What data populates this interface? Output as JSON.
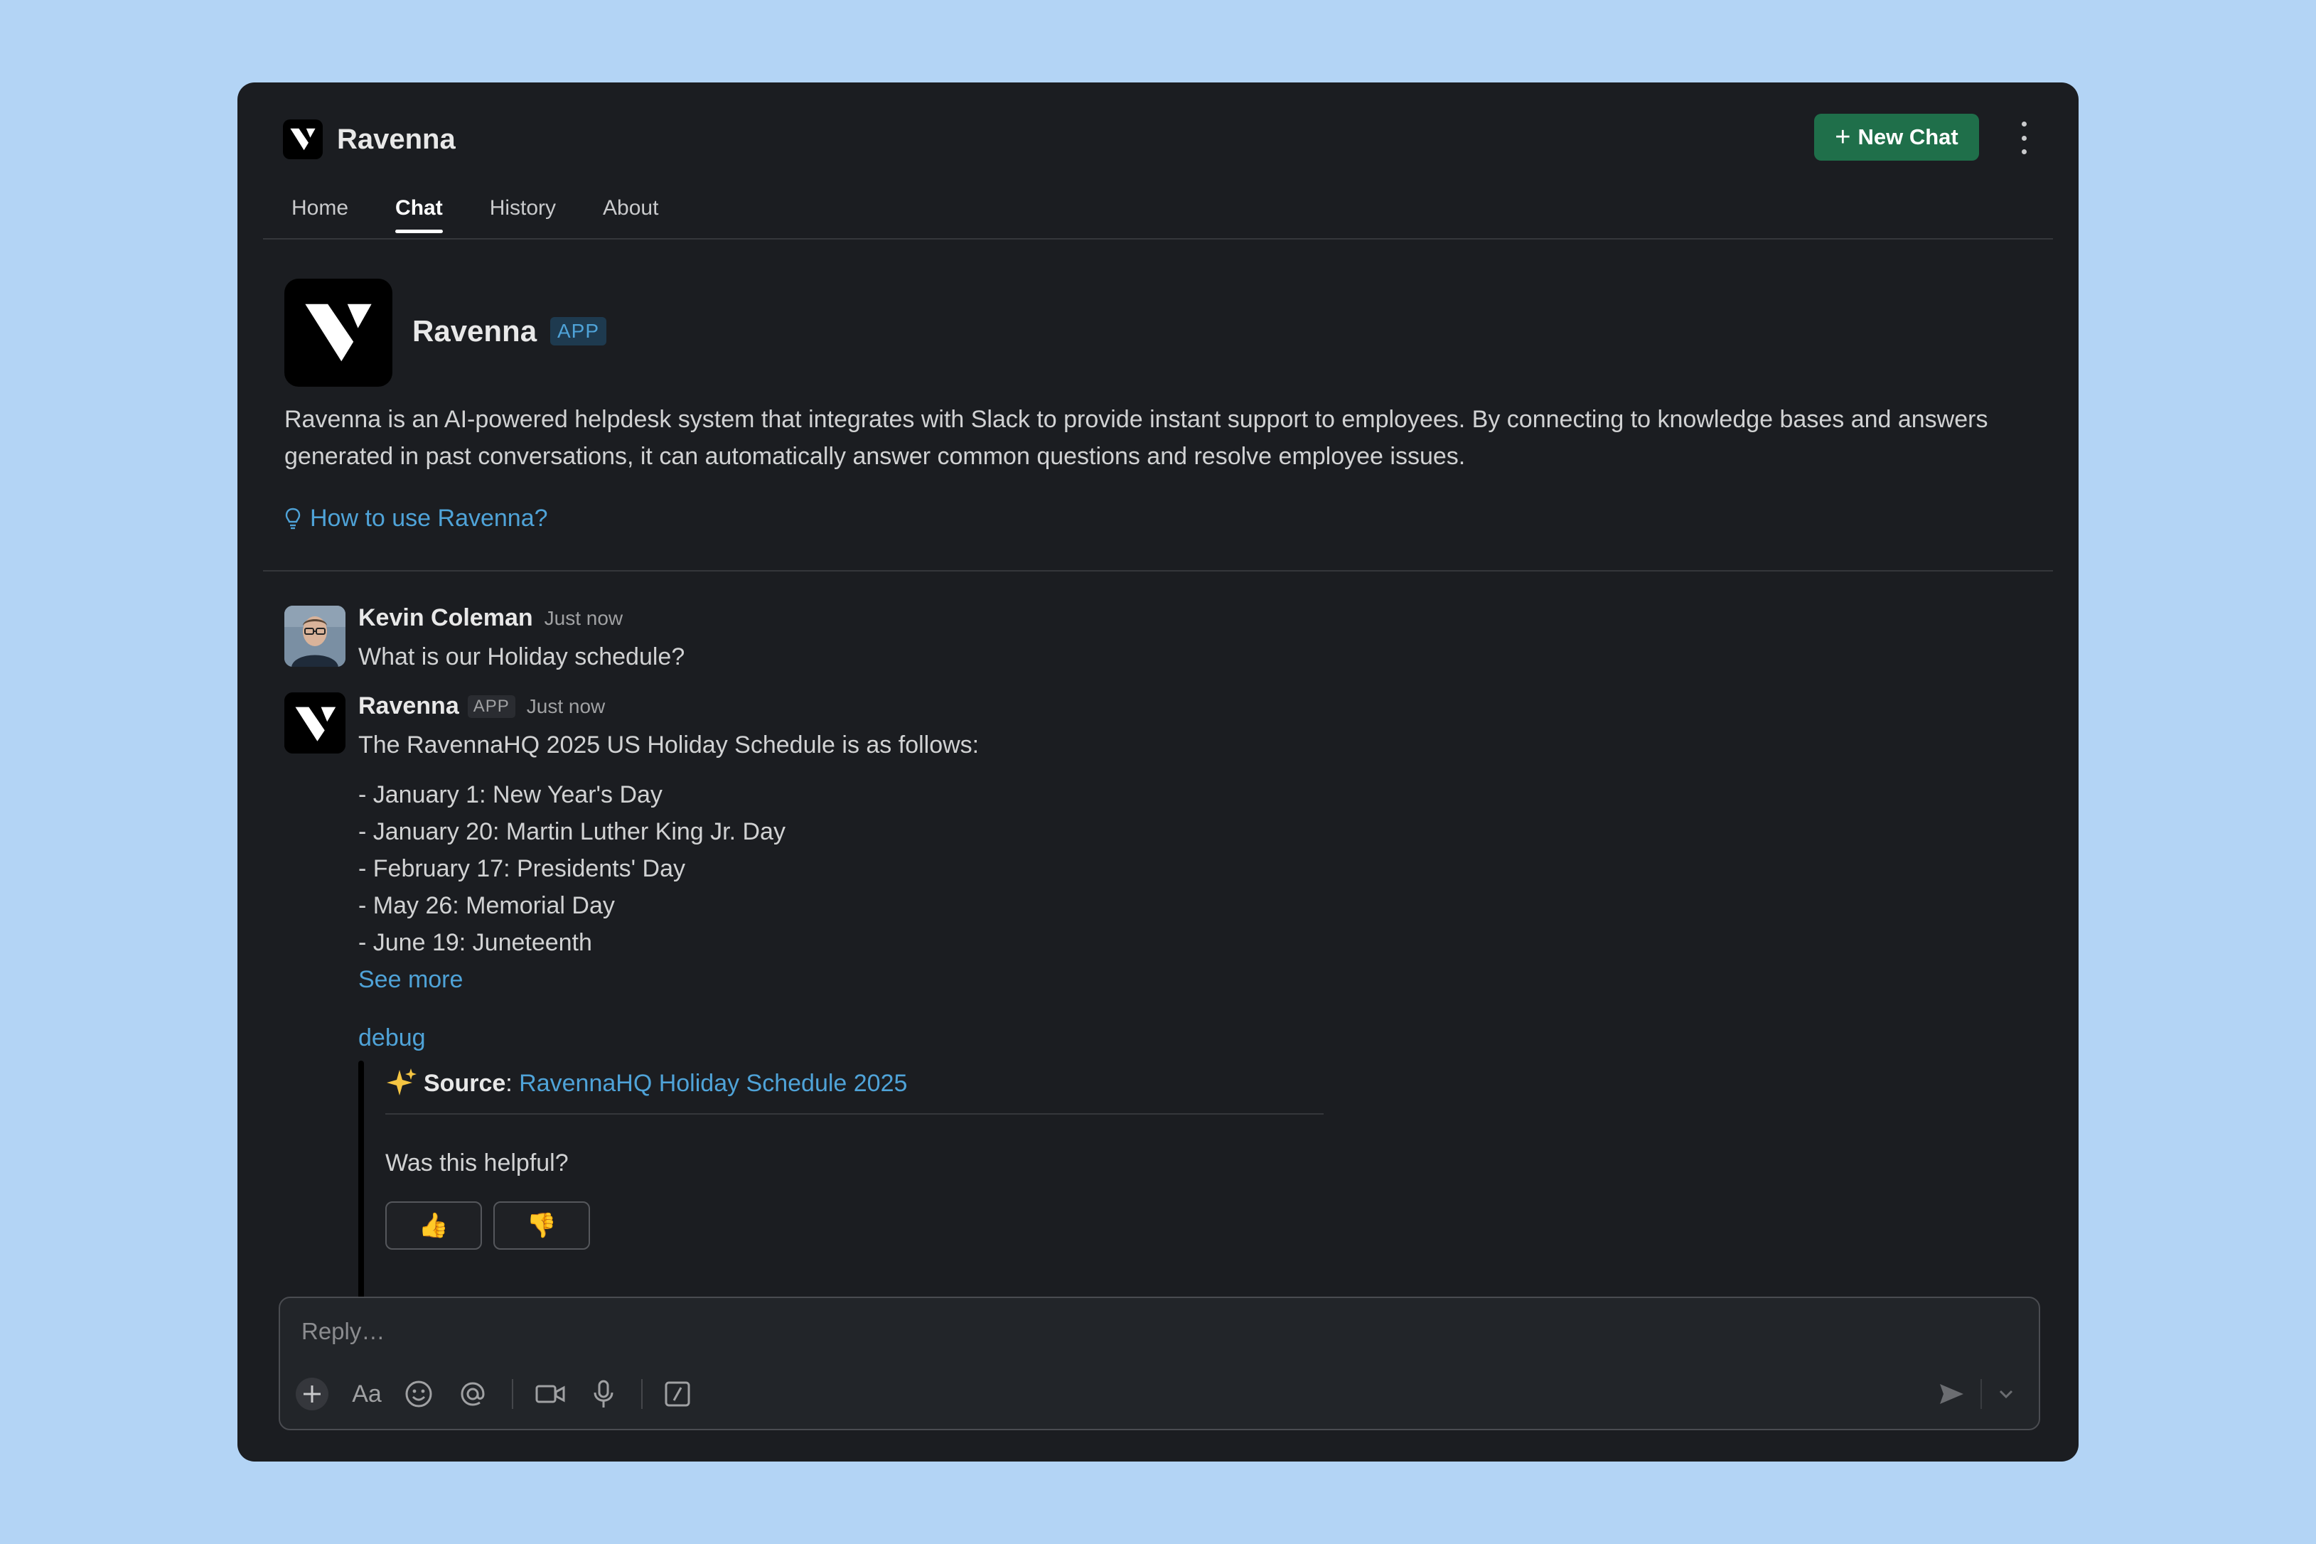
{
  "app": {
    "title": "Ravenna",
    "new_chat_label": "New Chat"
  },
  "tabs": [
    {
      "label": "Home",
      "active": false
    },
    {
      "label": "Chat",
      "active": true
    },
    {
      "label": "History",
      "active": false
    },
    {
      "label": "About",
      "active": false
    }
  ],
  "intro": {
    "name": "Ravenna",
    "badge": "APP",
    "description": "Ravenna is an AI-powered helpdesk system that integrates with Slack to provide instant support to employees. By connecting to knowledge bases and answers generated in past conversations, it can automatically answer common questions and resolve employee issues.",
    "howto_link": "How to use Ravenna?"
  },
  "messages": {
    "user": {
      "author": "Kevin Coleman",
      "time": "Just now",
      "text": "What is our Holiday schedule?"
    },
    "bot": {
      "author": "Ravenna",
      "badge": "APP",
      "time": "Just now",
      "intro": "The RavennaHQ 2025 US Holiday Schedule is as follows:",
      "items": [
        "- January 1: New Year's Day",
        "- January 20: Martin Luther King Jr. Day",
        "- February 17: Presidents' Day",
        "- May 26: Memorial Day",
        "- June 19: Juneteenth"
      ],
      "see_more": "See more",
      "debug": "debug",
      "source_label": "Source",
      "source_link": "RavennaHQ Holiday Schedule 2025",
      "helpful_prompt": "Was this helpful?"
    }
  },
  "composer": {
    "placeholder": "Reply…",
    "format_label": "Aa"
  },
  "colors": {
    "accent_green": "#1f6f4a",
    "link_blue": "#4fa3d8",
    "panel_bg": "#1b1d21",
    "page_bg": "#b3d4f5"
  }
}
